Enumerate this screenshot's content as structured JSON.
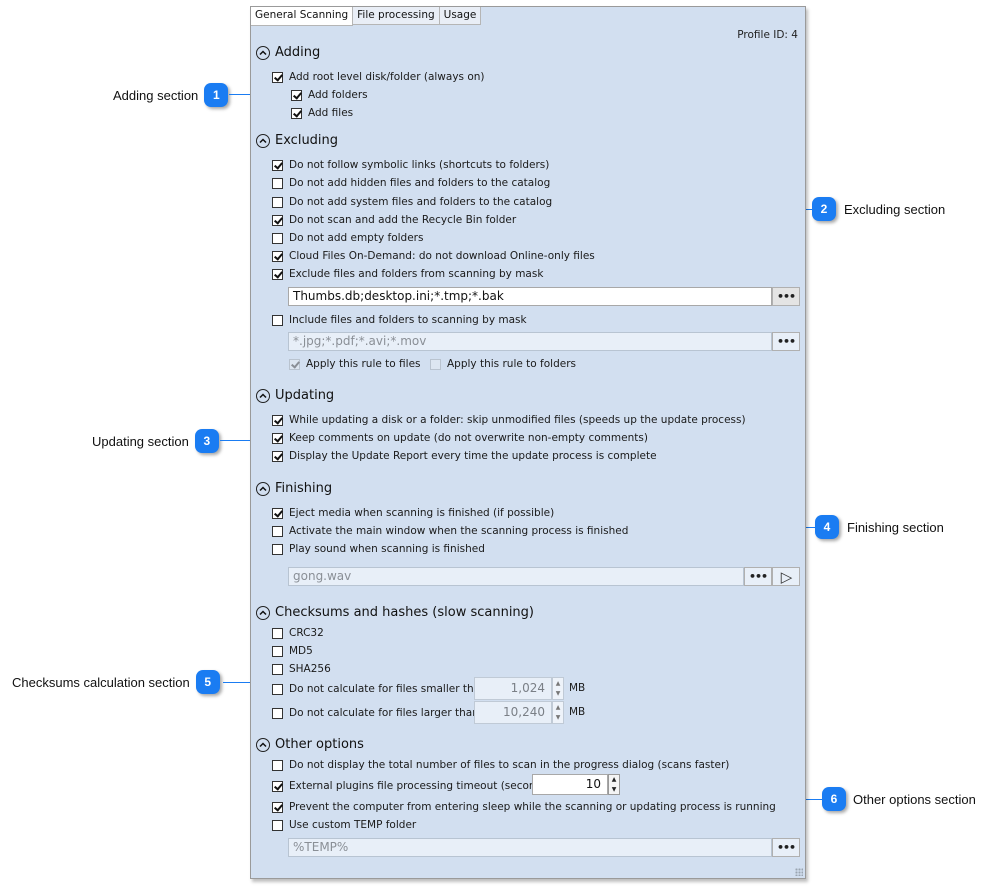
{
  "tabs": [
    {
      "label": "General Scanning",
      "active": true
    },
    {
      "label": "File processing",
      "active": false
    },
    {
      "label": "Usage",
      "active": false
    }
  ],
  "profile_id": "Profile ID: 4",
  "sections": {
    "adding": {
      "title": "Adding",
      "items": [
        {
          "label": "Add root level disk/folder (always on)",
          "checked": true
        },
        {
          "label": "Add folders",
          "checked": true
        },
        {
          "label": "Add files",
          "checked": true
        }
      ]
    },
    "excluding": {
      "title": "Excluding",
      "items": [
        {
          "label": "Do not follow symbolic links (shortcuts to folders)",
          "checked": true
        },
        {
          "label": "Do not add hidden files and folders to the catalog",
          "checked": false
        },
        {
          "label": "Do not add system files and folders to the catalog",
          "checked": false
        },
        {
          "label": "Do not scan and add the Recycle Bin folder",
          "checked": true
        },
        {
          "label": "Do not add empty folders",
          "checked": false
        },
        {
          "label": "Cloud Files On-Demand: do not download Online-only files",
          "checked": true
        },
        {
          "label": "Exclude files and folders from scanning by mask",
          "checked": true
        }
      ],
      "exclude_mask_value": "Thumbs.db;desktop.ini;*.tmp;*.bak",
      "include_mask": {
        "label": "Include files and folders to scanning by mask",
        "checked": false
      },
      "include_mask_value": "*.jpg;*.pdf;*.avi;*.mov",
      "apply_files": {
        "label": "Apply this rule to files",
        "checked": true
      },
      "apply_folders": {
        "label": "Apply this rule to folders",
        "checked": false
      },
      "browse_label": "•••"
    },
    "updating": {
      "title": "Updating",
      "items": [
        {
          "label": "While updating a disk or a folder: skip unmodified files (speeds up the update process)",
          "checked": true
        },
        {
          "label": "Keep comments on update (do not overwrite non-empty comments)",
          "checked": true
        },
        {
          "label": "Display the Update Report every time the update process is complete",
          "checked": true
        }
      ]
    },
    "finishing": {
      "title": "Finishing",
      "items": [
        {
          "label": "Eject media when scanning is finished (if possible)",
          "checked": true
        },
        {
          "label": "Activate the main window when the scanning process is finished",
          "checked": false
        },
        {
          "label": "Play sound when scanning is finished",
          "checked": false
        }
      ],
      "sound_file": "gong.wav",
      "play_icon": "▷"
    },
    "checksums": {
      "title": "Checksums and hashes (slow scanning)",
      "items": [
        {
          "label": "CRC32",
          "checked": false
        },
        {
          "label": "MD5",
          "checked": false
        },
        {
          "label": "SHA256",
          "checked": false
        }
      ],
      "smaller": {
        "label": "Do not calculate for files smaller than:",
        "checked": false,
        "value": "1,024",
        "unit": "MB"
      },
      "larger": {
        "label": "Do not calculate for files larger than:",
        "checked": false,
        "value": "10,240",
        "unit": "MB"
      }
    },
    "other": {
      "title": "Other options",
      "items": [
        {
          "label": "Do not display the total number of files to scan in the progress dialog (scans faster)",
          "checked": false
        },
        {
          "label": "External plugins file processing timeout (seconds):",
          "checked": true
        },
        {
          "label": "Prevent the computer from entering sleep while the scanning or updating process is running",
          "checked": true
        },
        {
          "label": "Use custom TEMP folder",
          "checked": false
        }
      ],
      "timeout_value": "10",
      "temp_value": "%TEMP%"
    }
  },
  "callouts": [
    {
      "number": "1",
      "label": "Adding section"
    },
    {
      "number": "2",
      "label": "Excluding section"
    },
    {
      "number": "3",
      "label": "Updating section"
    },
    {
      "number": "4",
      "label": "Finishing section"
    },
    {
      "number": "5",
      "label": "Checksums calculation section"
    },
    {
      "number": "6",
      "label": "Other options section"
    }
  ],
  "colors": {
    "accent": "#1a7cf2",
    "panel_bg": "#d2dff0"
  }
}
